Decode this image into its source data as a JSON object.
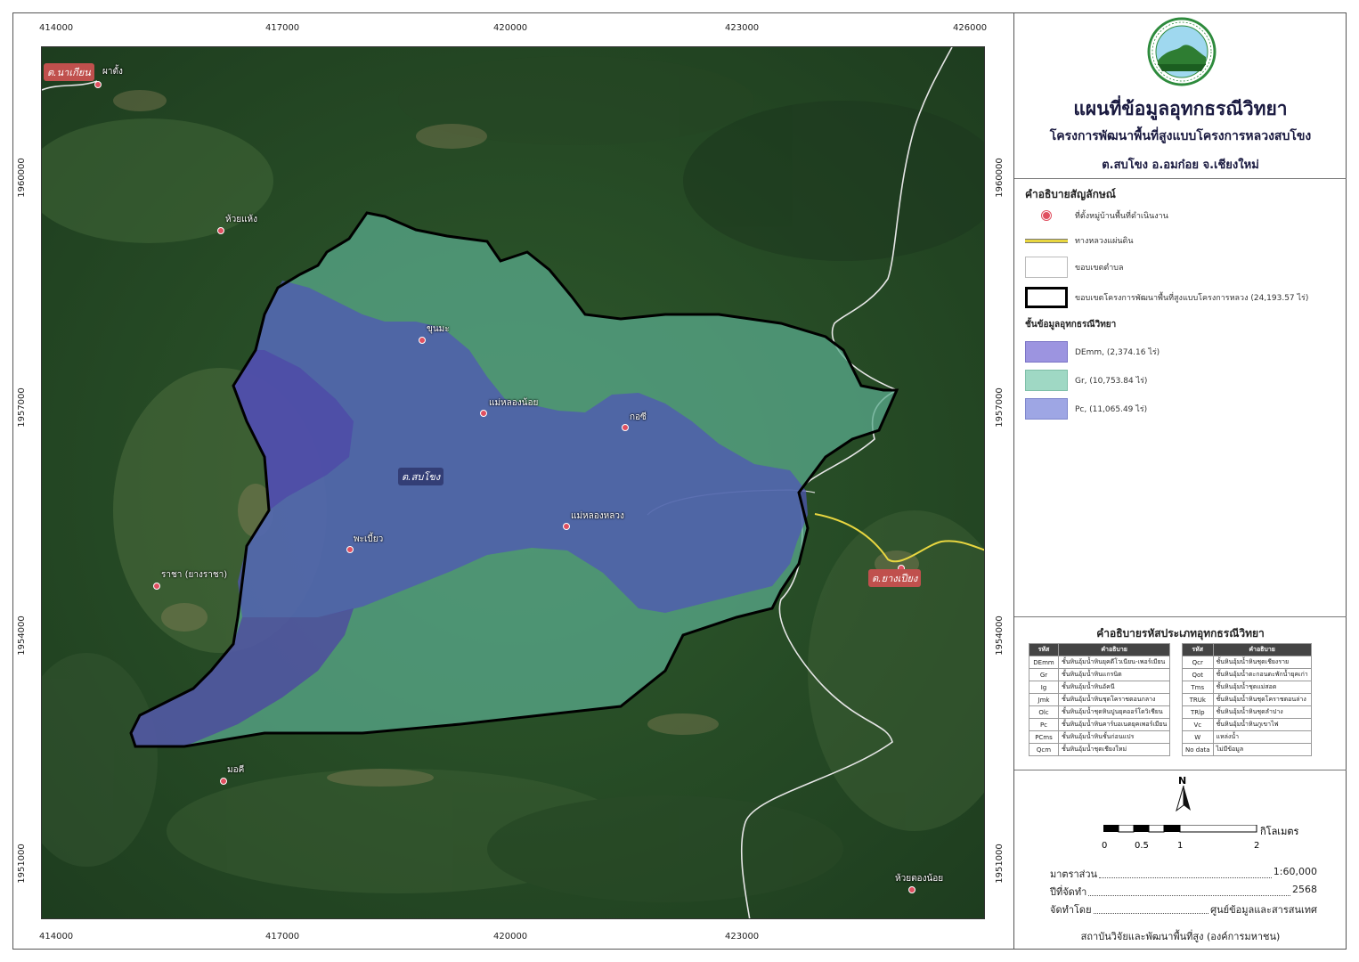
{
  "colors": {
    "demm": "#7b72d6",
    "gr": "#7fd3b3",
    "pc": "#7f86d9",
    "boundary": "#000000",
    "road": "#e8d640",
    "village": "#e05060"
  },
  "axis": {
    "x_ticks": [
      "414000",
      "417000",
      "420000",
      "423000",
      "426000"
    ],
    "y_ticks": [
      "1960000",
      "1957000",
      "1954000",
      "1951000"
    ]
  },
  "map_labels": {
    "tambon_top": "ต.นาเกียน",
    "tambon_center": "ต.สบโขง",
    "tambon_right": "ต.ยางเปียง",
    "villages": [
      {
        "name": "ผาตั้ง"
      },
      {
        "name": "ห้วยแห้ง"
      },
      {
        "name": "ขุนมะ"
      },
      {
        "name": "แม่หลองน้อย"
      },
      {
        "name": "กอซี"
      },
      {
        "name": "แม่หลองหลวง"
      },
      {
        "name": "พะเบี้ยว"
      },
      {
        "name": "ราชา (ยางราชา)"
      },
      {
        "name": "มอคี"
      },
      {
        "name": "ห้วยตองน้อย"
      }
    ]
  },
  "panel": {
    "title": "แผนที่ข้อมูลอุทกธรณีวิทยา",
    "subtitle": "โครงการพัฒนาพื้นที่สูงแบบโครงการหลวงสบโขง",
    "location": "ต.สบโขง อ.อมก๋อย จ.เชียงใหม่",
    "legend_title": "คำอธิบายสัญลักษณ์",
    "legend_items": {
      "village": "ที่ตั้งหมู่บ้านพื้นที่ดำเนินงาน",
      "road": "ทางหลวงแผ่นดิน",
      "tambon": "ขอบเขตตำบล",
      "project": "ขอบเขตโครงการพัฒนาพื้นที่สูงแบบโครงการหลวง (24,193.57 ไร่)"
    },
    "layer_title": "ชั้นข้อมูลอุทกธรณีวิทยา",
    "layers": {
      "demm": "DEmm, (2,374.16 ไร่)",
      "gr": "Gr, (10,753.84 ไร่)",
      "pc": "Pc, (11,065.49 ไร่)"
    },
    "code_title": "คำอธิบายรหัสประเภทอุทกธรณีวิทยา",
    "code_headers": {
      "code": "รหัส",
      "desc": "คำอธิบาย"
    },
    "codes_left": [
      {
        "code": "DEmm",
        "desc": "ชั้นหินอุ้มน้ำหินยุคดีโวเนียน-เพอร์เมียน"
      },
      {
        "code": "Gr",
        "desc": "ชั้นหินอุ้มน้ำหินแกรนิต"
      },
      {
        "code": "Ig",
        "desc": "ชั้นหินอุ้มน้ำหินอัคนี"
      },
      {
        "code": "Jmk",
        "desc": "ชั้นหินอุ้มน้ำหินชุดโคราชตอนกลาง"
      },
      {
        "code": "Olc",
        "desc": "ชั้นหินอุ้มน้ำชุดหินปูนยุคออร์โดวิเชียน"
      },
      {
        "code": "Pc",
        "desc": "ชั้นหินอุ้มน้ำหินคาร์บอเนตยุคเพอร์เมียน"
      },
      {
        "code": "PCms",
        "desc": "ชั้นหินอุ้มน้ำหินชั้นก่อนแปร"
      },
      {
        "code": "Qcm",
        "desc": "ชั้นหินอุ้มน้ำชุดเชียงใหม่"
      }
    ],
    "codes_right": [
      {
        "code": "Qcr",
        "desc": "ชั้นหินอุ้มน้ำหินชุดเชียงราย"
      },
      {
        "code": "Qot",
        "desc": "ชั้นหินอุ้มน้ำตะกอนตะพักน้ำยุคเก่า"
      },
      {
        "code": "Tms",
        "desc": "ชั้นหินอุ้มน้ำชุดแม่สอด"
      },
      {
        "code": "TRUk",
        "desc": "ชั้นหินอุ้มน้ำหินชุดโคราชตอนล่าง"
      },
      {
        "code": "TRlp",
        "desc": "ชั้นหินอุ้มน้ำหินชุดลำปาง"
      },
      {
        "code": "Vc",
        "desc": "ชั้นหินอุ้มน้ำหินภูเขาไฟ"
      },
      {
        "code": "W",
        "desc": "แหล่งน้ำ"
      },
      {
        "code": "No data",
        "desc": "ไม่มีข้อมูล"
      }
    ],
    "north": "N",
    "scale_ticks": [
      "0",
      "0.5",
      "1",
      "2"
    ],
    "scale_unit": "กิโลเมตร",
    "scale_label": "มาตราส่วน",
    "scale_value": "1:60,000",
    "year_label": "ปีที่จัดทำ",
    "year_value": "2568",
    "by_label": "จัดทำโดย",
    "by_value": "ศูนย์ข้อมูลและสารสนเทศ",
    "org": "สถาบันวิจัยและพัฒนาพื้นที่สูง (องค์การมหาชน)"
  }
}
